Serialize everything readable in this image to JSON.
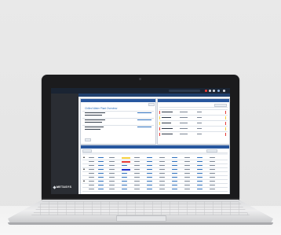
{
  "app": {
    "name": "",
    "screen_title": "",
    "sidebar_items": [
      "",
      ""
    ],
    "logo": "METASYS"
  },
  "panels": {
    "left_title": "",
    "right_title": "",
    "bottom_title": "",
    "overview_heading": "Chilled Water Plant Overview"
  },
  "colors": {
    "topbar": "#1a2433",
    "panel_header": "#27579f",
    "alarm_red": "#e53935",
    "alarm_yellow": "#f4d03f",
    "alarm_blue": "#1e2fd0"
  }
}
